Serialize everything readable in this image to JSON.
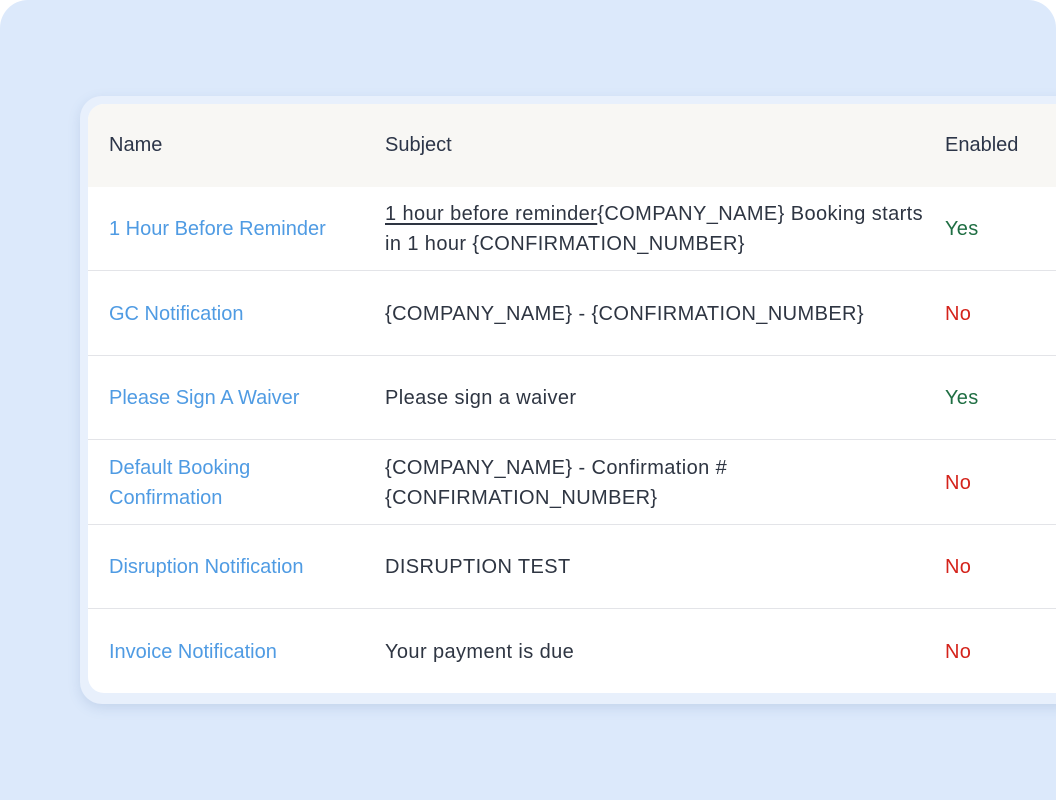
{
  "table": {
    "columns": {
      "name": "Name",
      "subject": "Subject",
      "enabled": "Enabled"
    },
    "rows": [
      {
        "name": "1 Hour Before Reminder",
        "subject_underlined": "1 hour before reminder",
        "subject": "{COMPANY_NAME} Booking starts in 1 hour {CONFIRMATION_NUMBER}",
        "enabled": "Yes",
        "enabled_state": true
      },
      {
        "name": "GC Notification",
        "subject_underlined": "",
        "subject": "{COMPANY_NAME} - {CONFIRMATION_NUMBER}",
        "enabled": "No",
        "enabled_state": false
      },
      {
        "name": "Please Sign A Waiver",
        "subject_underlined": "",
        "subject": "Please sign a waiver",
        "enabled": "Yes",
        "enabled_state": true
      },
      {
        "name": "Default Booking Confirmation",
        "subject_underlined": "",
        "subject": "{COMPANY_NAME} - Confirmation #{CONFIRMATION_NUMBER}",
        "enabled": "No",
        "enabled_state": false
      },
      {
        "name": "Disruption Notification",
        "subject_underlined": "",
        "subject": "DISRUPTION TEST",
        "enabled": "No",
        "enabled_state": false
      },
      {
        "name": "Invoice Notification",
        "subject_underlined": "",
        "subject": "Your payment is due",
        "enabled": "No",
        "enabled_state": false
      }
    ]
  },
  "colors": {
    "background": "#dce9fb",
    "link": "#4f9be3",
    "enabled_yes": "#1f6e43",
    "enabled_no": "#d4231b",
    "header_bg": "#f8f7f4"
  }
}
